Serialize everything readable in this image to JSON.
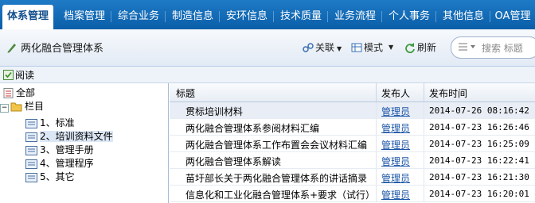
{
  "nav": {
    "tabs": [
      "体系管理",
      "档案管理",
      "综合业务",
      "制造信息",
      "安环信息",
      "技术质量",
      "业务流程",
      "个人事务",
      "其他信息",
      "OA管理"
    ],
    "active_index": 0
  },
  "titlebar": {
    "title": "两化融合管理体系",
    "link_label": "关联",
    "mode_label": "模式",
    "refresh_label": "刷新",
    "search_placeholder": "搜索 标题"
  },
  "actionbar": {
    "read_label": "阅读"
  },
  "tree": {
    "all": "全部",
    "folder": "栏目",
    "items": [
      "1、标准",
      "2、培训资料文件",
      "3、管理手册",
      "4、管理程序",
      "5、其它"
    ],
    "selected_index": 1
  },
  "table": {
    "headers": {
      "title": "标题",
      "publisher": "发布人",
      "time": "发布时间"
    },
    "rows": [
      {
        "title": "贯标培训材料",
        "publisher": "管理员",
        "time": "2014-07-26 08:16:42"
      },
      {
        "title": "两化融合管理体系参阅材料汇编",
        "publisher": "管理员",
        "time": "2014-07-23 16:26:46"
      },
      {
        "title": "两化融合管理体系工作布置会会议材料汇编",
        "publisher": "管理员",
        "time": "2014-07-23 16:25:09"
      },
      {
        "title": "两化融合管理体系解读",
        "publisher": "管理员",
        "time": "2014-07-23 16:22:41"
      },
      {
        "title": "苗圩部长关于两化融合管理体系的讲话摘录",
        "publisher": "管理员",
        "time": "2014-07-23 16:21:30"
      },
      {
        "title": "信息化和工业化融合管理体系+要求（试行）",
        "publisher": "管理员",
        "time": "2014-07-23 16:20:01"
      }
    ]
  },
  "colors": {
    "nav_bg": "#0a5ea8",
    "link": "#1a55a6"
  }
}
